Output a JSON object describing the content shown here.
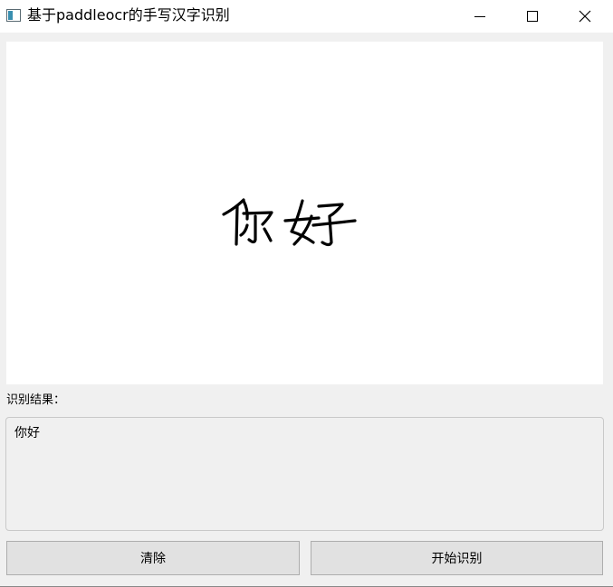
{
  "window": {
    "title": "基于paddleocr的手写汉字识别",
    "icon": "app-window-icon",
    "controls": {
      "minimize_icon": "minimize-icon",
      "maximize_icon": "maximize-icon",
      "close_icon": "close-icon"
    }
  },
  "canvas": {
    "drawn_text": "你好"
  },
  "result": {
    "label": "识别结果：",
    "value": "你好"
  },
  "buttons": {
    "clear_label": "清除",
    "recognize_label": "开始识别"
  },
  "colors": {
    "window_bg": "#f0f0f0",
    "canvas_bg": "#ffffff",
    "button_bg": "#e1e1e1",
    "ink": "#000000"
  }
}
